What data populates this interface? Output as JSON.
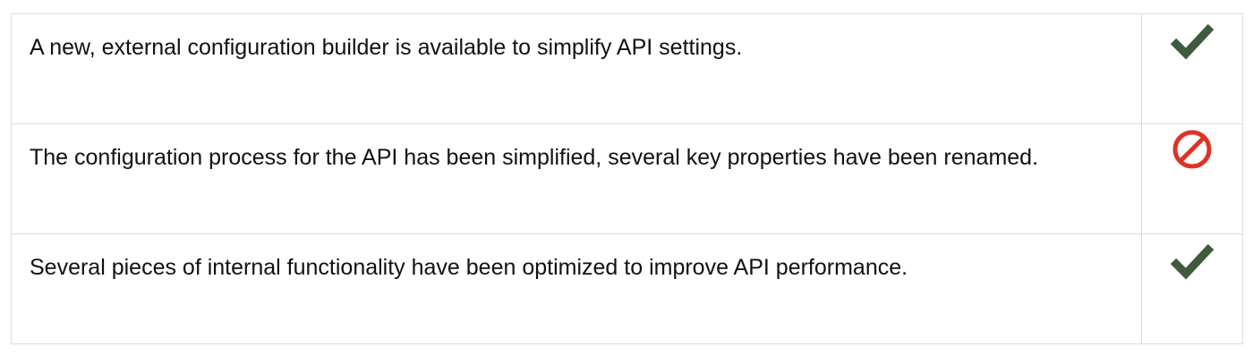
{
  "rows": [
    {
      "text": "A new, external configuration builder is available to simplify API settings.",
      "status": "check",
      "icon": "check-icon",
      "color": "#3f5a3d"
    },
    {
      "text": "The configuration process for the API has been simplified, several key properties have been renamed.",
      "status": "prohibited",
      "icon": "prohibited-icon",
      "color": "#dd3327"
    },
    {
      "text": "Several pieces of internal functionality have been optimized to improve API performance.",
      "status": "check",
      "icon": "check-icon",
      "color": "#3f5a3d"
    }
  ]
}
